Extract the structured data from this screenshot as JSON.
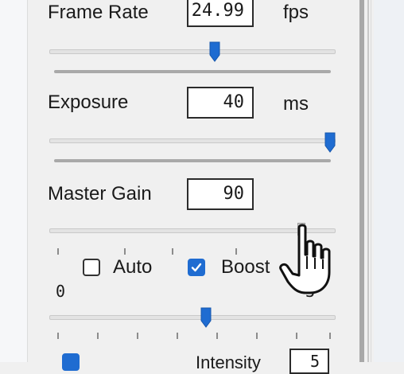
{
  "frame_rate": {
    "label": "Frame Rate",
    "value": "24.99",
    "unit": "fps",
    "slider_fraction": 0.58
  },
  "exposure": {
    "label": "Exposure",
    "value": "40",
    "unit": "ms",
    "slider_fraction": 1.0
  },
  "master_gain": {
    "label": "Master Gain",
    "value": "90",
    "slider_fraction": 0.9
  },
  "gain_options": {
    "auto_label": "Auto",
    "auto_checked": false,
    "boost_label": "Boost",
    "boost_checked": true
  },
  "gain_scale": {
    "min_label": "0",
    "max_label": "3",
    "slider_fraction": 0.55
  },
  "bottom_row": {
    "intensity_label": "Intensity",
    "intensity_value": "5",
    "checkbox_checked": true
  },
  "colors": {
    "accent": "#1f6cd1",
    "panel": "#f0f0f0",
    "border": "#2b2b2b"
  }
}
